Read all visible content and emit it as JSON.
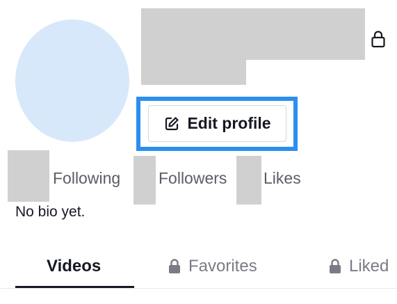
{
  "profile": {
    "edit_button_label": "Edit profile",
    "bio": "No bio yet."
  },
  "stats": [
    {
      "label": "Following"
    },
    {
      "label": "Followers"
    },
    {
      "label": "Likes"
    }
  ],
  "tabs": [
    {
      "label": "Videos",
      "active": true,
      "locked": false
    },
    {
      "label": "Favorites",
      "active": false,
      "locked": true
    },
    {
      "label": "Liked",
      "active": false,
      "locked": true
    }
  ],
  "icons": {
    "private_account": "lock-icon",
    "edit": "edit-pencil-icon",
    "tab_lock": "lock-icon"
  },
  "colors": {
    "highlight": "#2b8ff0",
    "avatar": "#d7e8fb",
    "redaction": "#d0d0d0",
    "text_primary": "#161823",
    "text_secondary": "#7a7c85"
  }
}
